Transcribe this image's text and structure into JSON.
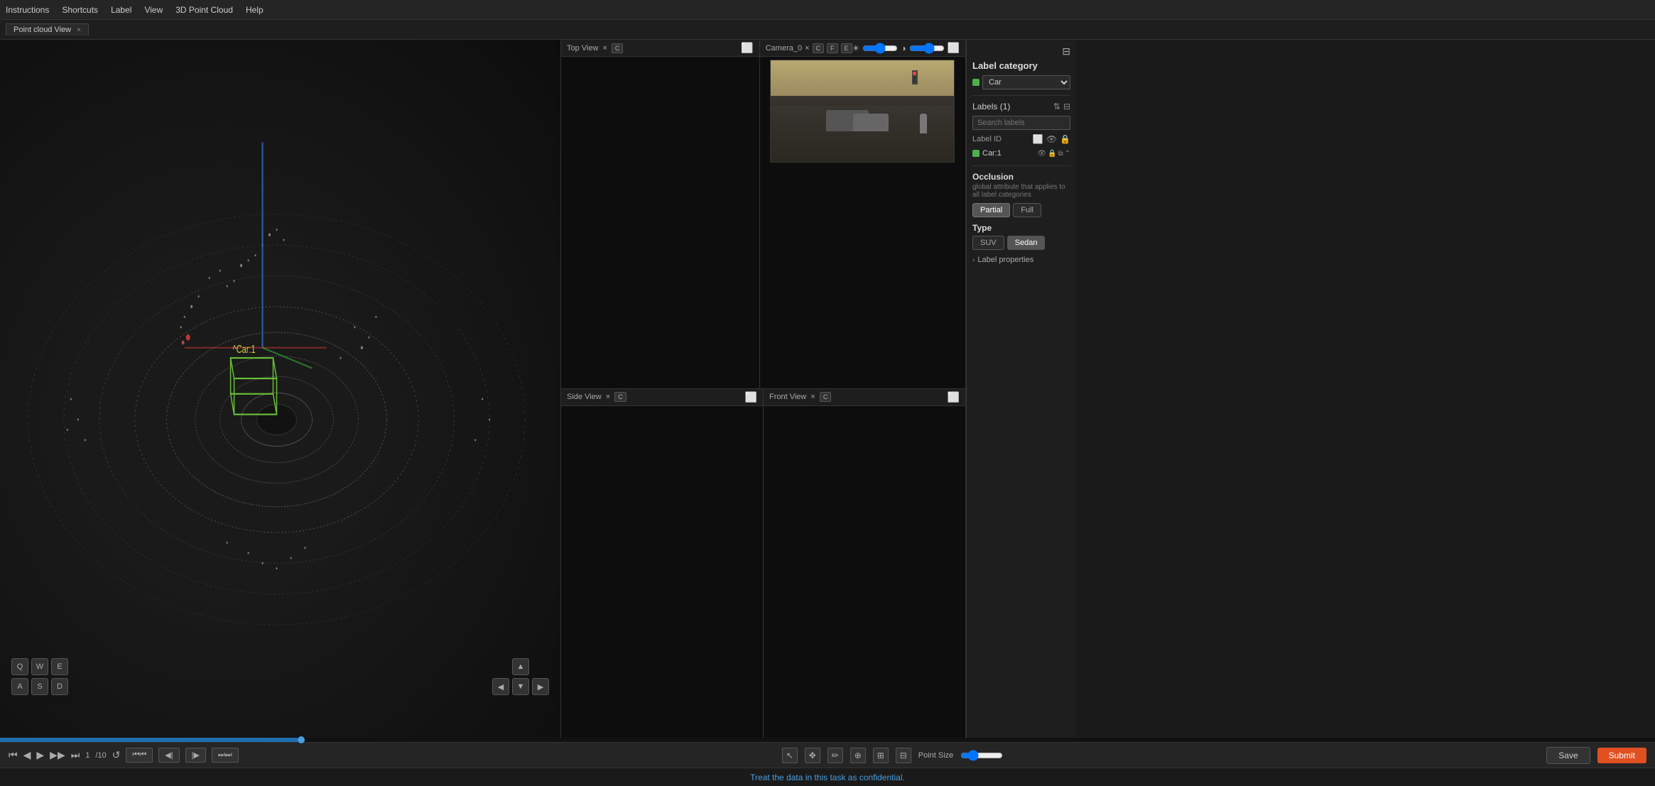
{
  "menubar": {
    "items": [
      "Instructions",
      "Shortcuts",
      "Label",
      "View",
      "3D Point Cloud",
      "Help"
    ]
  },
  "tabs": [
    {
      "label": "Point cloud View",
      "closeable": true
    }
  ],
  "pointcloud": {
    "title": "Point cloud View",
    "label_car": "^Car:1",
    "nav_keys": [
      [
        "Q",
        "W",
        "E"
      ],
      [
        "A",
        "S",
        "D"
      ]
    ]
  },
  "views": {
    "top": {
      "title": "Top View",
      "close": "×",
      "btn_c": "C"
    },
    "side": {
      "title": "Side View",
      "close": "×",
      "btn_c": "C"
    },
    "front": {
      "title": "Front View",
      "close": "×",
      "btn_c": "C"
    }
  },
  "camera": {
    "title": "Camera_0",
    "close": "×",
    "btn_c": "C",
    "btn_f": "F",
    "btn_e": "E"
  },
  "rightpanel": {
    "label_category_title": "Label category",
    "category_value": "Car",
    "labels_section": "Labels",
    "labels_count": "Labels (1)",
    "search_placeholder": "Search labels",
    "label_id_title": "Label ID",
    "label_item": "Car:1",
    "occlusion_title": "Occlusion",
    "occlusion_desc": "global attribute that applies to all label categories",
    "occlusion_partial": "Partial",
    "occlusion_full": "Full",
    "type_title": "Type",
    "type_suv": "SUV",
    "type_sedan": "Sedan",
    "label_props": "Label properties",
    "expand_icon": "›"
  },
  "toolbar": {
    "playback": {
      "back_start": "⏮",
      "back_step": "◀",
      "play": "▶",
      "forward_step": "▶",
      "forward_end": "⏭",
      "frame_current": "1",
      "frame_total": "/10",
      "refresh": "↺"
    },
    "tools": {
      "back_double": "⏮",
      "back_one": "◀",
      "forward_one": "▶",
      "forward_double": "⏭"
    },
    "point_size_label": "Point Size",
    "save_label": "Save",
    "submit_label": "Submit"
  },
  "confidential": {
    "text": "Treat the data in this task as confidential."
  },
  "icons": {
    "filter": "⊟",
    "sort": "⇅",
    "cuboid": "⬜",
    "lock": "🔒",
    "eye": "👁",
    "copy": "⧉",
    "delete": "🗑",
    "collapse": "⌃",
    "add": "+",
    "select": "↖",
    "move": "✥",
    "pencil": "✏",
    "crosshair": "⊕",
    "group": "⊞",
    "ungroup": "⊟"
  }
}
